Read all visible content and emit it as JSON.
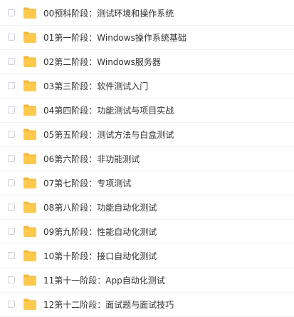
{
  "files": [
    {
      "name": "00预科阶段：测试环境和操作系统",
      "icon": "folder-icon",
      "checked": false
    },
    {
      "name": "01第一阶段：Windows操作系统基础",
      "icon": "folder-icon",
      "checked": false
    },
    {
      "name": "02第二阶段：Windows服务器",
      "icon": "folder-icon",
      "checked": false
    },
    {
      "name": "03第三阶段：软件测试入门",
      "icon": "folder-icon",
      "checked": false
    },
    {
      "name": "04第四阶段：功能测试与项目实战",
      "icon": "folder-icon",
      "checked": false
    },
    {
      "name": "05第五阶段：测试方法与白盒测试",
      "icon": "folder-icon",
      "checked": false
    },
    {
      "name": "06第六阶段：非功能测试",
      "icon": "folder-icon",
      "checked": false
    },
    {
      "name": "07第七阶段：专项测试",
      "icon": "folder-icon",
      "checked": false
    },
    {
      "name": "08第八阶段：功能自动化测试",
      "icon": "folder-icon",
      "checked": false
    },
    {
      "name": "09第九阶段：性能自动化测试",
      "icon": "folder-icon",
      "checked": false
    },
    {
      "name": "10第十阶段：接口自动化测试",
      "icon": "folder-icon",
      "checked": false
    },
    {
      "name": "11第十一阶段：App自动化测试",
      "icon": "folder-icon",
      "checked": false
    },
    {
      "name": "12第十二阶段：面试题与面试技巧",
      "icon": "folder-icon",
      "checked": false
    }
  ],
  "colors": {
    "folder_body": "#ffc94d",
    "folder_tab": "#f5b93b",
    "text": "#333333",
    "divider": "#f1f2f4",
    "checkbox_border": "#cfd3d9"
  }
}
